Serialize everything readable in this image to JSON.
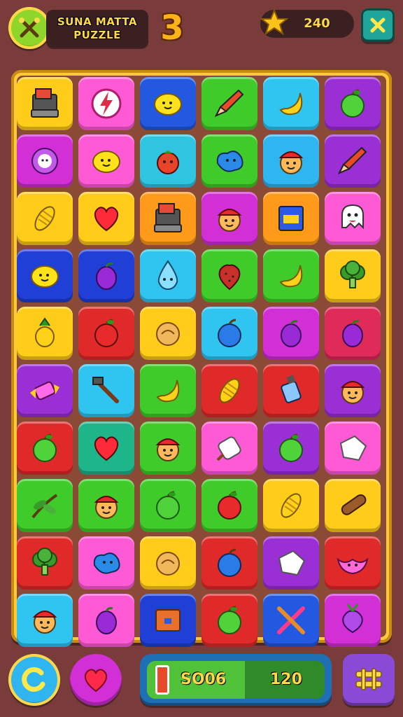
{
  "header": {
    "title_line1": "SUNA MATTA",
    "title_line2": "PUZZLE",
    "level": "3",
    "score": "240"
  },
  "colors": {
    "background": "#7a3b3b",
    "accent": "#ffd84a",
    "board_frame": "#ffc93a"
  },
  "icons": {
    "top_left": "crossed-tools-icon",
    "score": "star-icon",
    "close": "close-icon",
    "bottom_1": "restart-icon",
    "bottom_2": "heart-icon",
    "bottom_3": "menu-icon"
  },
  "board": {
    "tiles": [
      {
        "bg": "#ffcc1a",
        "icon": "cash-register"
      },
      {
        "bg": "#ff5ad6",
        "icon": "lightning-badge"
      },
      {
        "bg": "#2358e0",
        "icon": "lemon"
      },
      {
        "bg": "#3fcc2a",
        "icon": "pencil"
      },
      {
        "bg": "#2fc5f0",
        "icon": "banana"
      },
      {
        "bg": "#9b2fd6",
        "icon": "apple"
      },
      {
        "bg": "#d22fd6",
        "icon": "flower"
      },
      {
        "bg": "#ff5ad6",
        "icon": "lemon"
      },
      {
        "bg": "#2fc5e0",
        "icon": "tomato"
      },
      {
        "bg": "#3fcc2a",
        "icon": "blob"
      },
      {
        "bg": "#2fb5f0",
        "icon": "face"
      },
      {
        "bg": "#9b2fd6",
        "icon": "pencil"
      },
      {
        "bg": "#ffcc1a",
        "icon": "corn"
      },
      {
        "bg": "#ffcc1a",
        "icon": "heart"
      },
      {
        "bg": "#ff9a1a",
        "icon": "cash-register"
      },
      {
        "bg": "#d22fd6",
        "icon": "face"
      },
      {
        "bg": "#ff9a1a",
        "icon": "book"
      },
      {
        "bg": "#ff5ad6",
        "icon": "ghost"
      },
      {
        "bg": "#1f3fd6",
        "icon": "lemon"
      },
      {
        "bg": "#1f3fd6",
        "icon": "plum"
      },
      {
        "bg": "#2fc5f0",
        "icon": "drop"
      },
      {
        "bg": "#3fcc2a",
        "icon": "strawberry"
      },
      {
        "bg": "#3fcc2a",
        "icon": "banana"
      },
      {
        "bg": "#ffcc1a",
        "icon": "broccoli"
      },
      {
        "bg": "#ffcc1a",
        "icon": "pineapple"
      },
      {
        "bg": "#e02a2a",
        "icon": "apple-red"
      },
      {
        "bg": "#ffcc1a",
        "icon": "bread"
      },
      {
        "bg": "#2fc5f0",
        "icon": "blue-apple"
      },
      {
        "bg": "#d22fd6",
        "icon": "plum"
      },
      {
        "bg": "#e02a5a",
        "icon": "plum"
      },
      {
        "bg": "#9b2fd6",
        "icon": "candy"
      },
      {
        "bg": "#2fc5f0",
        "icon": "tools"
      },
      {
        "bg": "#3fcc2a",
        "icon": "banana"
      },
      {
        "bg": "#e02a2a",
        "icon": "corn"
      },
      {
        "bg": "#e02a2a",
        "icon": "bottle"
      },
      {
        "bg": "#9b2fd6",
        "icon": "face"
      },
      {
        "bg": "#e02a2a",
        "icon": "apple"
      },
      {
        "bg": "#1fb58a",
        "icon": "heart"
      },
      {
        "bg": "#3fcc2a",
        "icon": "face"
      },
      {
        "bg": "#ff5ad6",
        "icon": "marshmallow"
      },
      {
        "bg": "#9b2fd6",
        "icon": "apple"
      },
      {
        "bg": "#ff5ad6",
        "icon": "sugar"
      },
      {
        "bg": "#3fcc2a",
        "icon": "herb"
      },
      {
        "bg": "#3fcc2a",
        "icon": "face"
      },
      {
        "bg": "#3fcc2a",
        "icon": "apple"
      },
      {
        "bg": "#3fcc2a",
        "icon": "apple-red"
      },
      {
        "bg": "#ffcc1a",
        "icon": "corn"
      },
      {
        "bg": "#ffcc1a",
        "icon": "log"
      },
      {
        "bg": "#e02a2a",
        "icon": "broccoli"
      },
      {
        "bg": "#ff5ad6",
        "icon": "blob"
      },
      {
        "bg": "#ffcc1a",
        "icon": "bread"
      },
      {
        "bg": "#e02a2a",
        "icon": "blue-apple"
      },
      {
        "bg": "#9b2fd6",
        "icon": "sugar"
      },
      {
        "bg": "#e02a2a",
        "icon": "bat"
      },
      {
        "bg": "#2fc5f0",
        "icon": "face"
      },
      {
        "bg": "#ff5ad6",
        "icon": "plum"
      },
      {
        "bg": "#1f3fd6",
        "icon": "box"
      },
      {
        "bg": "#e02a2a",
        "icon": "apple"
      },
      {
        "bg": "#2358e0",
        "icon": "cross-sticks"
      },
      {
        "bg": "#d22fd6",
        "icon": "radish"
      }
    ]
  },
  "footer": {
    "progress_left": "SO06",
    "progress_right": "120",
    "progress_fraction": 0.55
  }
}
